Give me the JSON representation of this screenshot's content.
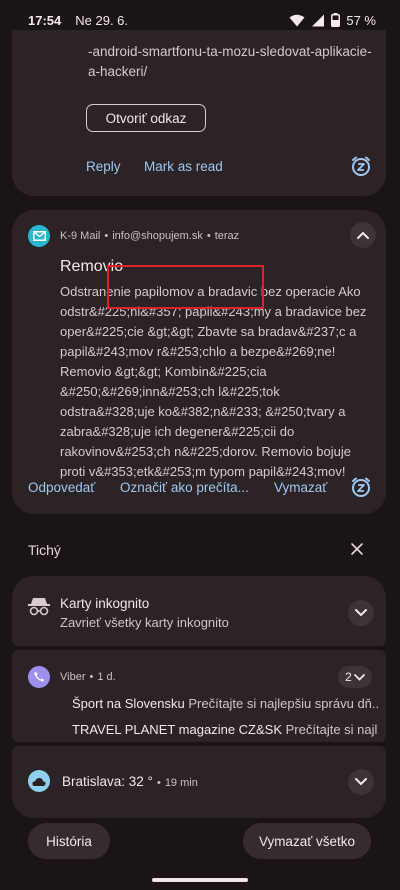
{
  "status_bar": {
    "time": "17:54",
    "date": "Ne 29. 6.",
    "battery": "57 %"
  },
  "top_notification": {
    "url_text": "-android-smartfonu-ta-mozu-sledovat-aplikacie-a-hackeri/",
    "open_link_label": "Otvoriť odkaz",
    "reply_label": "Reply",
    "mark_read_label": "Mark as read"
  },
  "mail_notification": {
    "app_name": "K-9 Mail",
    "account": "info@shopujem.sk",
    "time": "teraz",
    "separator": "•",
    "title": "Removio",
    "body": "Odstranenie papilomov a bradavic bez operacie Ako odstr&#225;ni&#357; papil&#243;my a bradavice bez oper&#225;cie &gt;&gt; Zbavte sa bradav&#237;c a papil&#243;mov r&#253;chlo a bezpe&#269;ne! Removio &gt;&gt; Kombin&#225;cia &#250;&#269;inn&#253;ch l&#225;tok odstra&#328;uje ko&#382;n&#233; &#250;tvary a zabra&#328;uje ich degener&#225;cii do rakovinov&#253;ch n&#225;dorov. Removio bojuje proti v&#353;etk&#253;m typom papil&#243;mov!",
    "reply_label": "Odpovedať",
    "mark_read_label": "Označiť ako prečíta...",
    "delete_label": "Vymazať"
  },
  "silent_section": {
    "title": "Tichý"
  },
  "incognito": {
    "title": "Karty inkognito",
    "subtitle": "Zavrieť všetky karty inkognito"
  },
  "viber": {
    "app_name": "Viber",
    "separator": "•",
    "time": "1 d.",
    "count": "2",
    "messages": [
      {
        "sender": "Šport na Slovensku",
        "text": "Prečítajte si najlepšiu správu dň..."
      },
      {
        "sender": "TRAVEL PLANET magazine CZ&SK",
        "text": "Prečítajte si najle..."
      }
    ]
  },
  "weather": {
    "title": "Bratislava: 32 °",
    "separator": "•",
    "time": "19 min"
  },
  "bottom": {
    "history_label": "História",
    "clear_all_label": "Vymazať všetko"
  },
  "colors": {
    "accent_action": "#9fc7f0",
    "highlight": "#e0202a",
    "k9_badge": "#2bb5cf",
    "viber_badge": "#9d8ff0",
    "weather_badge": "#8fd0ee"
  }
}
